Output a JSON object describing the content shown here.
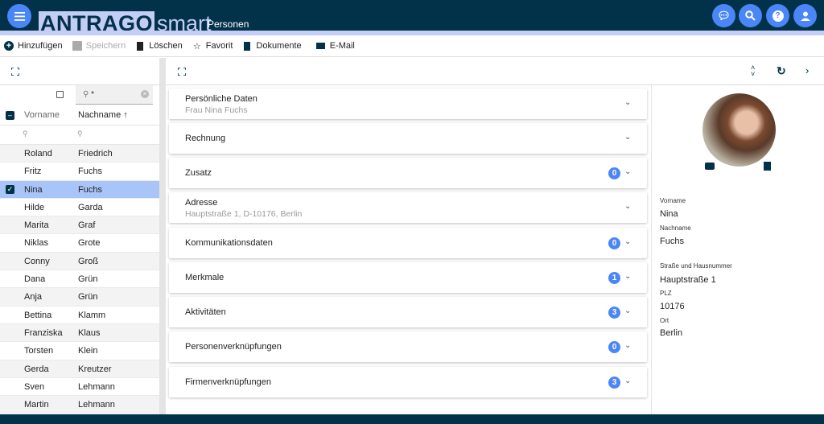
{
  "header": {
    "logo_main": "ANTRAGO",
    "logo_suffix": "smart",
    "module": "Personen",
    "colors": {
      "bar": "#01324a",
      "accent": "#4a86f7",
      "band": "#c3cdf6"
    }
  },
  "toolbar": {
    "add": "Hinzufügen",
    "save": "Speichern",
    "delete": "Löschen",
    "favorite": "Favorit",
    "documents": "Dokumente",
    "email": "E-Mail"
  },
  "list": {
    "search_value": "*",
    "col_first": "Vorname",
    "col_last": "Nachname",
    "sort_indicator": "↑",
    "rows": [
      [
        "Roland",
        "Friedrich"
      ],
      [
        "Fritz",
        "Fuchs"
      ],
      [
        "Nina",
        "Fuchs"
      ],
      [
        "Hilde",
        "Garda"
      ],
      [
        "Marita",
        "Graf"
      ],
      [
        "Niklas",
        "Grote"
      ],
      [
        "Conny",
        "Groß"
      ],
      [
        "Dana",
        "Grün"
      ],
      [
        "Anja",
        "Grün"
      ],
      [
        "Bettina",
        "Klamm"
      ],
      [
        "Franziska",
        "Klaus"
      ],
      [
        "Torsten",
        "Klein"
      ],
      [
        "Gerda",
        "Kreutzer"
      ],
      [
        "Sven",
        "Lehmann"
      ],
      [
        "Martin",
        "Lehmann"
      ]
    ],
    "selected_index": 2
  },
  "sections": [
    {
      "title": "Persönliche Daten",
      "subtitle": "Frau Nina Fuchs"
    },
    {
      "title": "Rechnung"
    },
    {
      "title": "Zusatz",
      "badge": "0"
    },
    {
      "title": "Adresse",
      "subtitle": "Hauptstraße 1, D-10176, Berlin"
    },
    {
      "title": "Kommunikationsdaten",
      "badge": "0"
    },
    {
      "title": "Merkmale",
      "badge": "1"
    },
    {
      "title": "Aktivitäten",
      "badge": "3"
    },
    {
      "title": "Personenverknüpfungen",
      "badge": "0"
    },
    {
      "title": "Firmenverknüpfungen",
      "badge": "3"
    }
  ],
  "detail": {
    "fields": [
      {
        "label": "Vorname",
        "value": "Nina"
      },
      {
        "label": "Nachname",
        "value": "Fuchs"
      },
      {
        "label": "Straße und Hausnummer",
        "value": "Hauptstraße 1"
      },
      {
        "label": "PLZ",
        "value": "10176"
      },
      {
        "label": "Ort",
        "value": "Berlin"
      }
    ]
  }
}
